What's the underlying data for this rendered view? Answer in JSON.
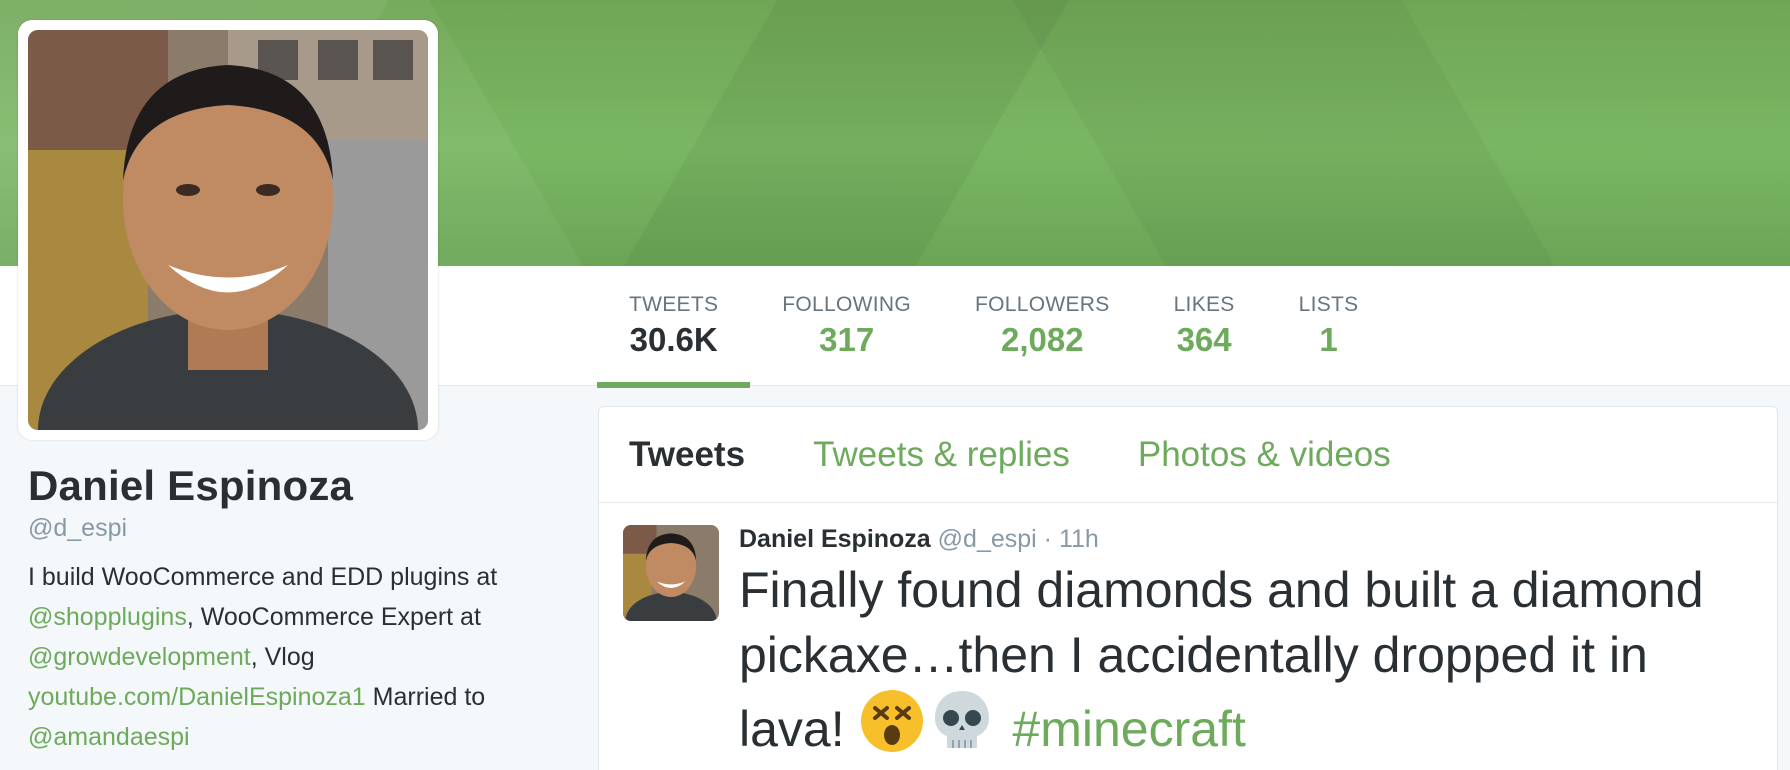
{
  "colors": {
    "accent": "#6daa5c",
    "banner": "#7ab763",
    "text": "#292f33",
    "muted": "#8899a6"
  },
  "profile": {
    "name": "Daniel Espinoza",
    "handle": "@d_espi",
    "bio": {
      "line1_prefix": "I build WooCommerce and EDD plugins at ",
      "mention1": "@shopplugins",
      "line1_middle": ", WooCommerce Expert at ",
      "mention2": "@growdevelopment",
      "line1_suffix": ", Vlog ",
      "link": "youtube.com/DanielEspinoza1",
      "married_text": " Married to ",
      "mention3": "@amandaespi"
    },
    "avatar_icon": "profile-photo"
  },
  "stats": [
    {
      "label": "TWEETS",
      "value": "30.6K"
    },
    {
      "label": "FOLLOWING",
      "value": "317"
    },
    {
      "label": "FOLLOWERS",
      "value": "2,082"
    },
    {
      "label": "LIKES",
      "value": "364"
    },
    {
      "label": "LISTS",
      "value": "1"
    }
  ],
  "tabs": [
    {
      "label": "Tweets"
    },
    {
      "label": "Tweets & replies"
    },
    {
      "label": "Photos & videos"
    }
  ],
  "tweet": {
    "author": "Daniel Espinoza",
    "handle": "@d_espi",
    "separator": " · ",
    "time": "11h",
    "text": "Finally found diamonds and built a diamond pickaxe…then I accidentally dropped it in lava! ",
    "emoji": [
      "dizzy-face-emoji",
      "skull-emoji"
    ],
    "hashtag": "#minecraft"
  }
}
